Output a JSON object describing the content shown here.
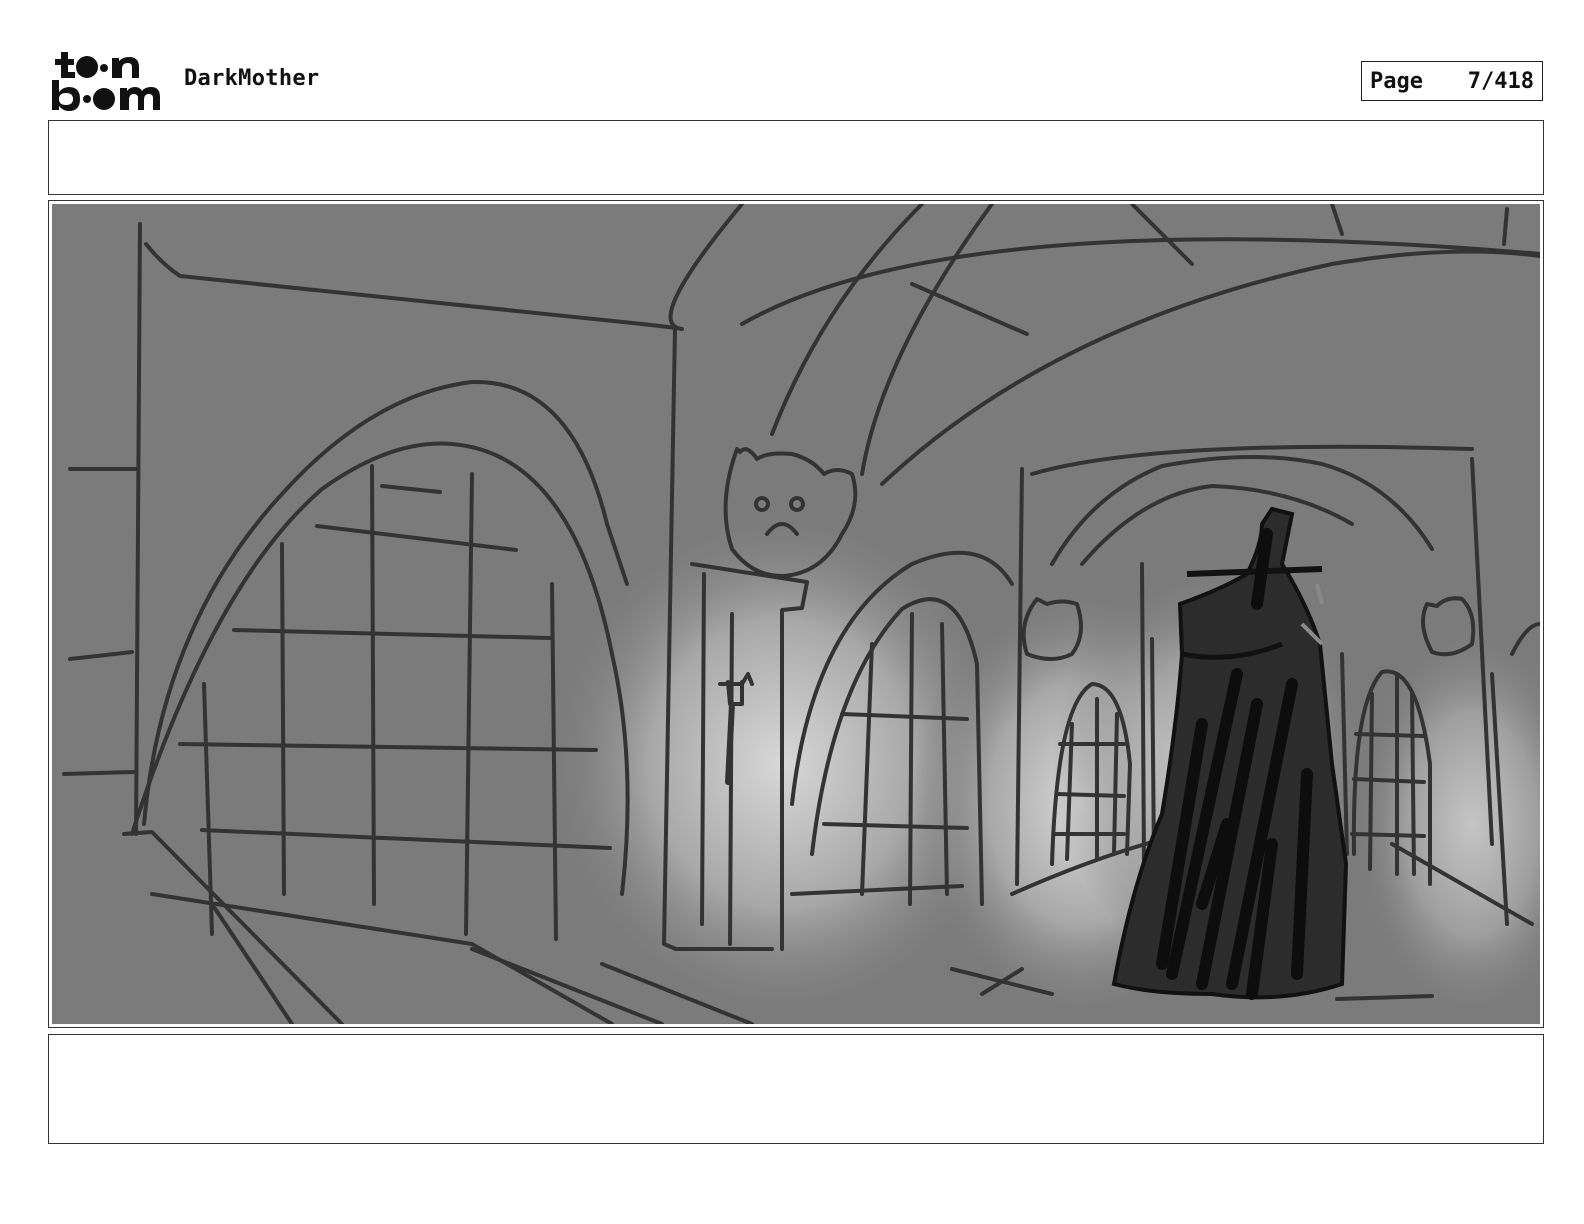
{
  "header": {
    "logo_top": "t•n",
    "logo_bottom": "b•m",
    "project_title": "DarkMother",
    "page_label": "Page",
    "page_number": "7/418"
  },
  "panel": {
    "description_icon": "storyboard-sketch"
  }
}
